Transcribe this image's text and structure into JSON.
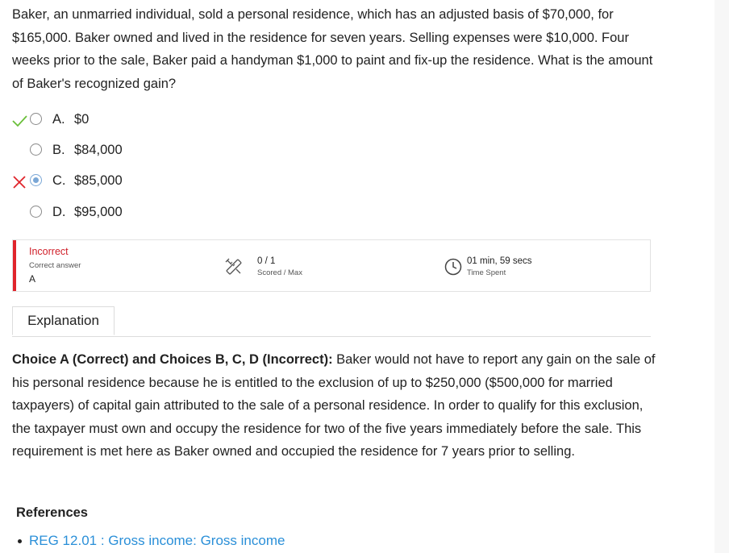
{
  "question": {
    "text": "Baker, an unmarried individual, sold a personal residence, which has an adjusted basis of $70,000, for $165,000. Baker owned and lived in the residence for seven years. Selling expenses were $10,000. Four weeks prior to the sale, Baker paid a handyman $1,000 to paint and fix-up the residence. What is the amount of Baker's recognized gain?"
  },
  "choices": [
    {
      "letter": "A.",
      "text": "$0",
      "mark": "check-icon",
      "selected": false
    },
    {
      "letter": "B.",
      "text": "$84,000",
      "mark": "",
      "selected": false
    },
    {
      "letter": "C.",
      "text": "$85,000",
      "mark": "x-icon",
      "selected": true
    },
    {
      "letter": "D.",
      "text": "$95,000",
      "mark": "",
      "selected": false
    }
  ],
  "result": {
    "status": "Incorrect",
    "correct_answer_label": "Correct answer",
    "correct_answer": "A",
    "score": "0 / 1",
    "score_label": "Scored / Max",
    "time": "01 min, 59 secs",
    "time_label": "Time Spent"
  },
  "tabs": {
    "explanation": "Explanation"
  },
  "explanation": {
    "lead": "Choice A (Correct) and Choices B, C, D (Incorrect):",
    "body": " Baker would not have to report any gain on the sale of his personal residence because he is entitled to the exclusion of up to $250,000 ($500,000 for married taxpayers) of capital gain attributed to the sale of a personal residence. In order to qualify for this exclusion, the taxpayer must own and occupy the residence for two of the five years immediately before the sale. This requirement is met here as Baker owned and occupied the residence for 7 years prior to selling."
  },
  "references": {
    "title": "References",
    "items": [
      {
        "label": "REG 12.01 : Gross income: Gross income"
      }
    ]
  },
  "colors": {
    "incorrect": "#e0242b",
    "correct_check": "#6abf3a",
    "link": "#2a8fd8",
    "selected_radio": "#7aa7d6"
  }
}
